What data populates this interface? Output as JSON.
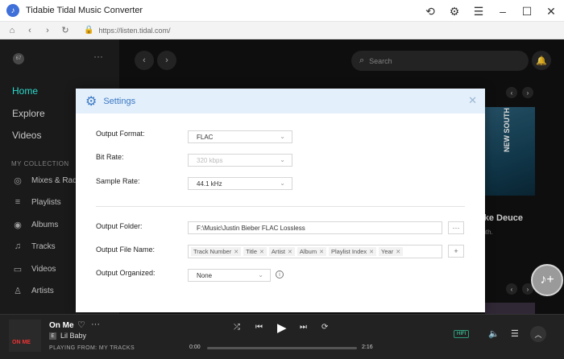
{
  "window": {
    "title": "Tidabie Tidal Music Converter",
    "icons": [
      "history-icon",
      "gear-icon",
      "menu-icon",
      "minimize-icon",
      "maximize-icon",
      "close-icon"
    ]
  },
  "address": {
    "url": "https://listen.tidal.com/"
  },
  "sidebar": {
    "avatar_text": "67",
    "nav": [
      {
        "label": "Home",
        "active": true
      },
      {
        "label": "Explore"
      },
      {
        "label": "Videos"
      }
    ],
    "section_title": "MY COLLECTION",
    "collection": [
      {
        "label": "Mixes & Radio",
        "icon": "mixes-icon"
      },
      {
        "label": "Playlists",
        "icon": "playlists-icon"
      },
      {
        "label": "Albums",
        "icon": "albums-icon"
      },
      {
        "label": "Tracks",
        "icon": "tracks-icon"
      },
      {
        "label": "Videos",
        "icon": "videos-icon"
      },
      {
        "label": "Artists",
        "icon": "artists-icon"
      }
    ]
  },
  "main": {
    "search_placeholder": "Search",
    "album_cover_text": "NEW SOUTH",
    "side_title": "uke Deuce",
    "side_sub": "outh."
  },
  "settings": {
    "title": "Settings",
    "output_format_label": "Output Format:",
    "output_format_value": "FLAC",
    "bit_rate_label": "Bit Rate:",
    "bit_rate_value": "320 kbps",
    "sample_rate_label": "Sample Rate:",
    "sample_rate_value": "44.1 kHz",
    "output_folder_label": "Output Folder:",
    "output_folder_value": "F:\\Music\\Justin Bieber FLAC Lossless",
    "browse_label": "···",
    "file_name_label": "Output File Name:",
    "file_name_tags": [
      "Track Number",
      "Title",
      "Artist",
      "Album",
      "Playlist Index",
      "Year"
    ],
    "add_label": "+",
    "organized_label": "Output Organized:",
    "organized_value": "None"
  },
  "player": {
    "cover_text": "ON ME",
    "song": "On Me",
    "explicit": "E",
    "artist": "Lil Baby",
    "playing_from": "PLAYING FROM: MY TRACKS",
    "time_current": "0:00",
    "time_total": "2:16",
    "progress": 0.0,
    "quality": "HIFI",
    "accent": "#33ffee"
  }
}
